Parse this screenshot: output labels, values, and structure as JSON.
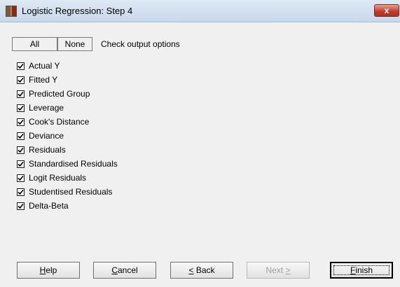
{
  "window": {
    "title": "Logistic Regression: Step 4",
    "close_glyph": "x"
  },
  "toolbar": {
    "all_label": "All",
    "none_label": "None",
    "description": "Check output options"
  },
  "options": [
    {
      "label": "Actual Y",
      "checked": true
    },
    {
      "label": "Fitted Y",
      "checked": true
    },
    {
      "label": "Predicted Group",
      "checked": true
    },
    {
      "label": "Leverage",
      "checked": true
    },
    {
      "label": "Cook's Distance",
      "checked": true
    },
    {
      "label": "Deviance",
      "checked": true
    },
    {
      "label": "Residuals",
      "checked": true
    },
    {
      "label": "Standardised Residuals",
      "checked": true
    },
    {
      "label": "Logit Residuals",
      "checked": true
    },
    {
      "label": "Studentised Residuals",
      "checked": true
    },
    {
      "label": "Delta-Beta",
      "checked": true
    }
  ],
  "buttons": {
    "help": {
      "prefix": "",
      "mnemonic": "H",
      "rest": "elp",
      "enabled": true
    },
    "cancel": {
      "prefix": "",
      "mnemonic": "C",
      "rest": "ancel",
      "enabled": true
    },
    "back": {
      "prefix": "",
      "mnemonic": "<",
      "rest": " Back",
      "enabled": true
    },
    "next": {
      "prefix": "Next ",
      "mnemonic": ">",
      "rest": "",
      "enabled": false
    },
    "finish": {
      "prefix": "",
      "mnemonic": "F",
      "rest": "inish",
      "enabled": true
    }
  }
}
